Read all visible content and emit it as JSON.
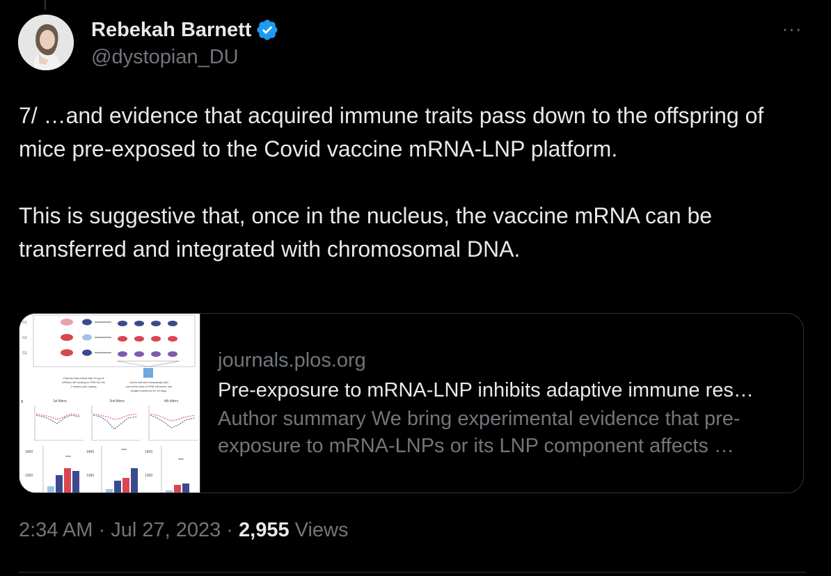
{
  "tweet": {
    "author": {
      "name": "Rebekah Barnett",
      "handle": "@dystopian_DU",
      "verified": true
    },
    "more_label": "···",
    "text_paragraphs": [
      "7/ …and evidence that acquired immune traits pass down to the offspring of mice pre-exposed to the Covid vaccine mRNA-LNP platform.",
      "This is suggestive that, once in the nucleus, the vaccine mRNA can be transferred and integrated with chromosomal DNA."
    ],
    "card": {
      "domain": "journals.plos.org",
      "title": "Pre-exposure to mRNA-LNP inhibits adaptive immune res…",
      "description": "Author summary We bring experimental evidence that pre-exposure to mRNA-LNPs or its LNP component affects …",
      "thumbnail": {
        "row_labels": [
          "G1",
          "G2",
          "G3"
        ],
        "note_left": "Parents immunized with 10 μg of mRNA-LNP coding for PR8 Flu HA 2 weeks prior mating",
        "note_right": "Litters infected intranasally with sub-lethal dose of PR8 influenza, and weight monitored for 14 days.",
        "litter_labels": [
          "1st litters",
          "2nd litters",
          "4th litters"
        ],
        "axis_value_top": "1400",
        "axis_value_bottom": "1300",
        "significance": "****"
      }
    },
    "meta": {
      "time": "2:34 AM",
      "separator": "·",
      "date": "Jul 27, 2023",
      "views_count": "2,955",
      "views_label": "Views"
    },
    "colors": {
      "background": "#000000",
      "primary_text": "#e7e9ea",
      "secondary_text": "#71767b",
      "border": "#2f3336",
      "verified_badge": "#1d9bf0"
    }
  }
}
